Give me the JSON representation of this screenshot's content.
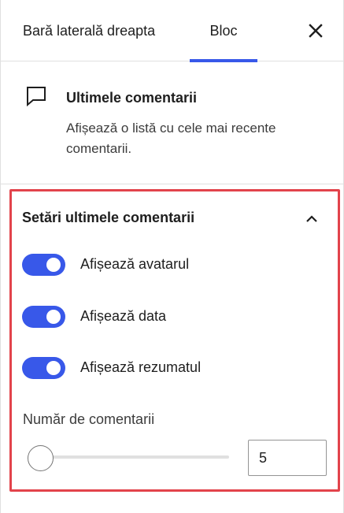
{
  "tabs": {
    "sidebar_label": "Bară laterală dreapta",
    "block_label": "Bloc",
    "active": "Bloc",
    "accent_color": "#3858e9"
  },
  "close_icon": "close-icon",
  "block_card": {
    "icon": "comment-icon",
    "title": "Ultimele comentarii",
    "description": "Afișează o listă cu cele mai recente comentarii."
  },
  "settings": {
    "title": "Setări ultimele comentarii",
    "expanded": true,
    "toggles": [
      {
        "label": "Afișează avatarul",
        "on": true
      },
      {
        "label": "Afișează data",
        "on": true
      },
      {
        "label": "Afișează rezumatul",
        "on": true
      }
    ],
    "count_label": "Număr de comentarii",
    "count_value": "5",
    "highlight_color": "#e2434b"
  }
}
